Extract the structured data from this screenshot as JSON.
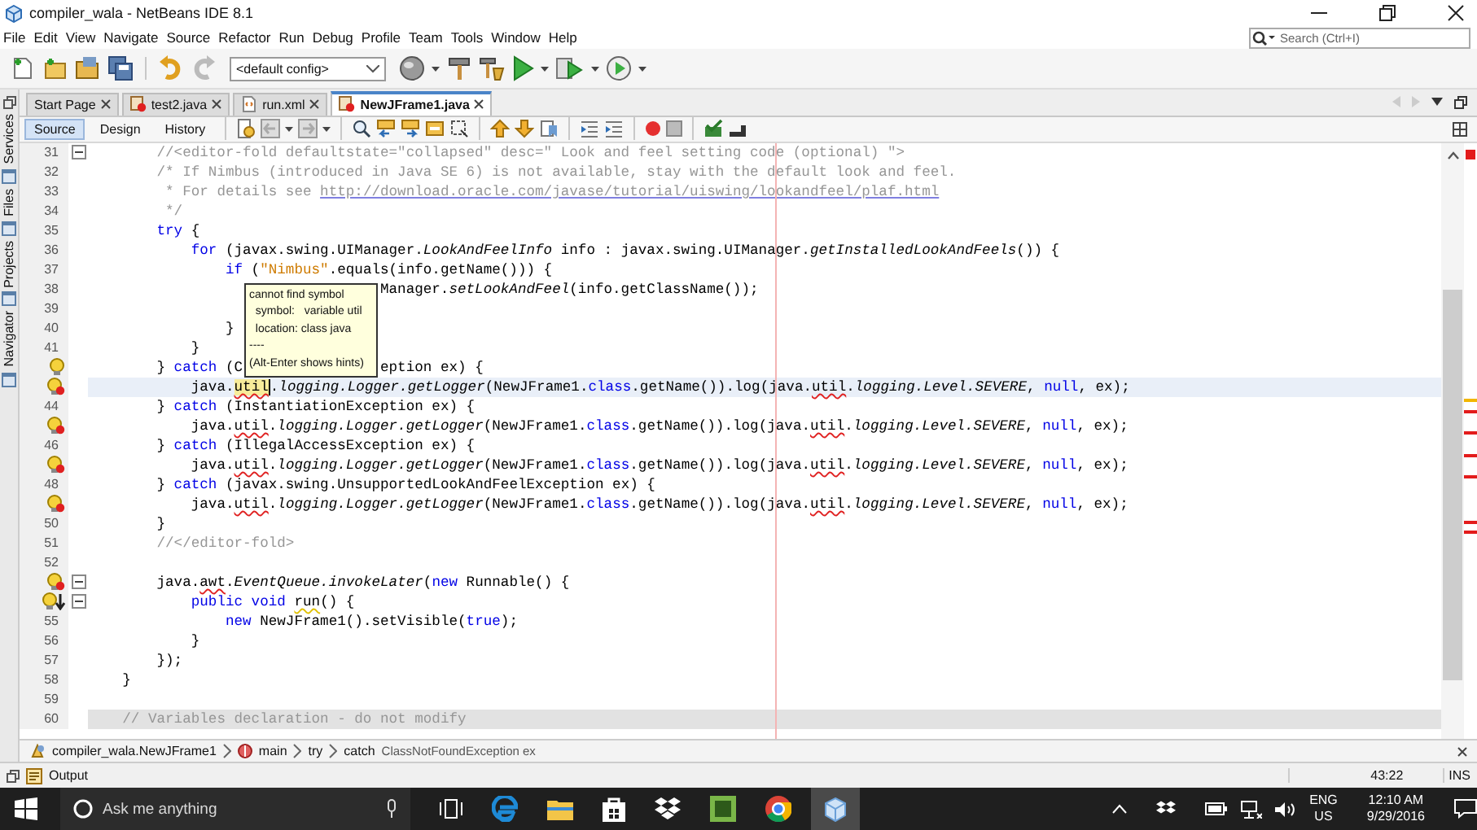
{
  "window": {
    "title": "compiler_wala - NetBeans IDE 8.1"
  },
  "menu": [
    "File",
    "Edit",
    "View",
    "Navigate",
    "Source",
    "Refactor",
    "Run",
    "Debug",
    "Profile",
    "Team",
    "Tools",
    "Window",
    "Help"
  ],
  "search": {
    "placeholder": "Search (Ctrl+I)"
  },
  "toolbar": {
    "config": "<default config>"
  },
  "side_tabs": [
    "Services",
    "Files",
    "Projects",
    "Navigator"
  ],
  "tabs": [
    {
      "label": "Start Page",
      "selected": false,
      "kind": "page"
    },
    {
      "label": "test2.java",
      "selected": false,
      "kind": "java-error"
    },
    {
      "label": "run.xml",
      "selected": false,
      "kind": "xml"
    },
    {
      "label": "NewJFrame1.java",
      "selected": true,
      "kind": "java-error"
    }
  ],
  "views": [
    {
      "label": "Source",
      "selected": true
    },
    {
      "label": "Design",
      "selected": false
    },
    {
      "label": "History",
      "selected": false
    }
  ],
  "editor": {
    "lines": [
      {
        "kind": "numbered",
        "number": "31",
        "fold": true,
        "current": false,
        "guarded": false,
        "segments": [
          {
            "kind": "comment",
            "text": "        //<editor-fold defaultstate=\"collapsed\" desc=\" Look and feel setting code (optional) \">"
          }
        ]
      },
      {
        "kind": "numbered",
        "number": "32",
        "fold": false,
        "current": false,
        "guarded": false,
        "segments": [
          {
            "kind": "comment",
            "text": "        /* If Nimbus (introduced in Java SE 6) is not available, stay with the default look and feel."
          }
        ]
      },
      {
        "kind": "numbered",
        "number": "33",
        "fold": false,
        "current": false,
        "guarded": false,
        "segments": [
          {
            "kind": "comment",
            "text": "         * For details see "
          },
          {
            "kind": "link",
            "text": "http://download.oracle.com/javase/tutorial/uiswing/lookandfeel/plaf.html"
          }
        ]
      },
      {
        "kind": "numbered",
        "number": "34",
        "fold": false,
        "current": false,
        "guarded": false,
        "segments": [
          {
            "kind": "comment",
            "text": "         */"
          }
        ]
      },
      {
        "kind": "numbered",
        "number": "35",
        "fold": false,
        "current": false,
        "guarded": false,
        "segments": [
          {
            "kind": "keyword",
            "text": "        try"
          },
          {
            "kind": "plain",
            "text": " {"
          }
        ]
      },
      {
        "kind": "numbered",
        "number": "36",
        "fold": false,
        "current": false,
        "guarded": false,
        "segments": [
          {
            "kind": "keyword",
            "text": "            for"
          },
          {
            "kind": "plain",
            "text": " (javax.swing.UIManager."
          },
          {
            "kind": "italic",
            "text": "LookAndFeelInfo"
          },
          {
            "kind": "plain",
            "text": " info : javax.swing.UIManager."
          },
          {
            "kind": "italic",
            "text": "getInstalledLookAndFeels"
          },
          {
            "kind": "plain",
            "text": "()) {"
          }
        ]
      },
      {
        "kind": "numbered",
        "number": "37",
        "fold": false,
        "current": false,
        "guarded": false,
        "segments": [
          {
            "kind": "keyword",
            "text": "                if"
          },
          {
            "kind": "plain",
            "text": " ("
          },
          {
            "kind": "string",
            "text": "\"Nimbus\""
          },
          {
            "kind": "plain",
            "text": ".equals(info.getName())) {"
          }
        ]
      },
      {
        "kind": "numbered",
        "number": "38",
        "fold": false,
        "current": false,
        "guarded": false,
        "segments": [
          {
            "kind": "covered"
          },
          {
            "kind": "plain",
            "text": "Manager."
          },
          {
            "kind": "italic",
            "text": "setLookAndFeel"
          },
          {
            "kind": "plain",
            "text": "(info.getClassName());"
          }
        ]
      },
      {
        "kind": "numbered",
        "number": "39",
        "fold": false,
        "current": false,
        "guarded": false
      },
      {
        "kind": "numbered",
        "number": "40",
        "fold": false,
        "current": false,
        "guarded": false,
        "segments": [
          {
            "kind": "plain",
            "text": "                }"
          }
        ]
      },
      {
        "kind": "numbered",
        "number": "41",
        "fold": false,
        "current": false,
        "guarded": false,
        "segments": [
          {
            "kind": "plain",
            "text": "            }"
          }
        ]
      },
      {
        "kind": "hint",
        "fold": false,
        "current": false,
        "guarded": false,
        "segments": [
          {
            "kind": "plain",
            "text": "        } "
          },
          {
            "kind": "keyword",
            "text": "catch"
          },
          {
            "kind": "plain",
            "text": " (C"
          },
          {
            "kind": "covered"
          },
          {
            "kind": "plain",
            "text": "eption ex) {"
          }
        ]
      },
      {
        "kind": "error",
        "fold": false,
        "current": true,
        "guarded": false,
        "segments": [
          {
            "kind": "plain",
            "text": "            java."
          },
          {
            "kind": "marked",
            "text": "util"
          },
          {
            "kind": "plain",
            "text": "."
          },
          {
            "kind": "italic",
            "text": "logging.Logger.getLogger"
          },
          {
            "kind": "plain",
            "text": "(NewJFrame1."
          },
          {
            "kind": "keyword",
            "text": "class"
          },
          {
            "kind": "plain",
            "text": ".getName()).log(java."
          },
          {
            "kind": "error",
            "text": "util"
          },
          {
            "kind": "plain",
            "text": "."
          },
          {
            "kind": "italic",
            "text": "logging.Level.SEVERE"
          },
          {
            "kind": "plain",
            "text": ", "
          },
          {
            "kind": "keyword",
            "text": "null"
          },
          {
            "kind": "plain",
            "text": ", ex);"
          }
        ]
      },
      {
        "kind": "numbered",
        "number": "44",
        "fold": false,
        "current": false,
        "guarded": false,
        "segments": [
          {
            "kind": "plain",
            "text": "        } "
          },
          {
            "kind": "keyword",
            "text": "catch"
          },
          {
            "kind": "plain",
            "text": " (InstantiationException ex) {"
          }
        ]
      },
      {
        "kind": "error",
        "fold": false,
        "current": false,
        "guarded": false,
        "segments": [
          {
            "kind": "plain",
            "text": "            java."
          },
          {
            "kind": "error",
            "text": "util"
          },
          {
            "kind": "plain",
            "text": "."
          },
          {
            "kind": "italic",
            "text": "logging.Logger.getLogger"
          },
          {
            "kind": "plain",
            "text": "(NewJFrame1."
          },
          {
            "kind": "keyword",
            "text": "class"
          },
          {
            "kind": "plain",
            "text": ".getName()).log(java."
          },
          {
            "kind": "error",
            "text": "util"
          },
          {
            "kind": "plain",
            "text": "."
          },
          {
            "kind": "italic",
            "text": "logging.Level.SEVERE"
          },
          {
            "kind": "plain",
            "text": ", "
          },
          {
            "kind": "keyword",
            "text": "null"
          },
          {
            "kind": "plain",
            "text": ", ex);"
          }
        ]
      },
      {
        "kind": "numbered",
        "number": "46",
        "fold": false,
        "current": false,
        "guarded": false,
        "segments": [
          {
            "kind": "plain",
            "text": "        } "
          },
          {
            "kind": "keyword",
            "text": "catch"
          },
          {
            "kind": "plain",
            "text": " (IllegalAccessException ex) {"
          }
        ]
      },
      {
        "kind": "error",
        "fold": false,
        "current": false,
        "guarded": false,
        "segments": [
          {
            "kind": "plain",
            "text": "            java."
          },
          {
            "kind": "error",
            "text": "util"
          },
          {
            "kind": "plain",
            "text": "."
          },
          {
            "kind": "italic",
            "text": "logging.Logger.getLogger"
          },
          {
            "kind": "plain",
            "text": "(NewJFrame1."
          },
          {
            "kind": "keyword",
            "text": "class"
          },
          {
            "kind": "plain",
            "text": ".getName()).log(java."
          },
          {
            "kind": "error",
            "text": "util"
          },
          {
            "kind": "plain",
            "text": "."
          },
          {
            "kind": "italic",
            "text": "logging.Level.SEVERE"
          },
          {
            "kind": "plain",
            "text": ", "
          },
          {
            "kind": "keyword",
            "text": "null"
          },
          {
            "kind": "plain",
            "text": ", ex);"
          }
        ]
      },
      {
        "kind": "numbered",
        "number": "48",
        "fold": false,
        "current": false,
        "guarded": false,
        "segments": [
          {
            "kind": "plain",
            "text": "        } "
          },
          {
            "kind": "keyword",
            "text": "catch"
          },
          {
            "kind": "plain",
            "text": " (javax.swing.UnsupportedLookAndFeelException ex) {"
          }
        ]
      },
      {
        "kind": "error",
        "fold": false,
        "current": false,
        "guarded": false,
        "segments": [
          {
            "kind": "plain",
            "text": "            java."
          },
          {
            "kind": "error",
            "text": "util"
          },
          {
            "kind": "plain",
            "text": "."
          },
          {
            "kind": "italic",
            "text": "logging.Logger.getLogger"
          },
          {
            "kind": "plain",
            "text": "(NewJFrame1."
          },
          {
            "kind": "keyword",
            "text": "class"
          },
          {
            "kind": "plain",
            "text": ".getName()).log(java."
          },
          {
            "kind": "error",
            "text": "util"
          },
          {
            "kind": "plain",
            "text": "."
          },
          {
            "kind": "italic",
            "text": "logging.Level.SEVERE"
          },
          {
            "kind": "plain",
            "text": ", "
          },
          {
            "kind": "keyword",
            "text": "null"
          },
          {
            "kind": "plain",
            "text": ", ex);"
          }
        ]
      },
      {
        "kind": "numbered",
        "number": "50",
        "fold": false,
        "current": false,
        "guarded": false,
        "segments": [
          {
            "kind": "plain",
            "text": "        }"
          }
        ]
      },
      {
        "kind": "numbered",
        "number": "51",
        "fold": false,
        "current": false,
        "guarded": false,
        "segments": [
          {
            "kind": "comment",
            "text": "        //</editor-fold>"
          }
        ]
      },
      {
        "kind": "numbered",
        "number": "52",
        "fold": false,
        "current": false,
        "guarded": false
      },
      {
        "kind": "error",
        "fold": true,
        "current": false,
        "guarded": false,
        "segments": [
          {
            "kind": "plain",
            "text": "        java."
          },
          {
            "kind": "error",
            "text": "awt"
          },
          {
            "kind": "plain",
            "text": "."
          },
          {
            "kind": "italic",
            "text": "EventQueue.invokeLater"
          },
          {
            "kind": "plain",
            "text": "("
          },
          {
            "kind": "keyword",
            "text": "new"
          },
          {
            "kind": "plain",
            "text": " Runnable() {"
          }
        ]
      },
      {
        "kind": "override",
        "fold": true,
        "current": false,
        "guarded": false,
        "segments": [
          {
            "kind": "keyword",
            "text": "            public void "
          },
          {
            "kind": "warning",
            "text": "run"
          },
          {
            "kind": "plain",
            "text": "() {"
          }
        ]
      },
      {
        "kind": "numbered",
        "number": "55",
        "fold": false,
        "current": false,
        "guarded": false,
        "segments": [
          {
            "kind": "keyword",
            "text": "                new"
          },
          {
            "kind": "plain",
            "text": " NewJFrame1().setVisible("
          },
          {
            "kind": "keyword",
            "text": "true"
          },
          {
            "kind": "plain",
            "text": ");"
          }
        ]
      },
      {
        "kind": "numbered",
        "number": "56",
        "fold": false,
        "current": false,
        "guarded": false,
        "segments": [
          {
            "kind": "plain",
            "text": "            }"
          }
        ]
      },
      {
        "kind": "numbered",
        "number": "57",
        "fold": false,
        "current": false,
        "guarded": false,
        "segments": [
          {
            "kind": "plain",
            "text": "        });"
          }
        ]
      },
      {
        "kind": "numbered",
        "number": "58",
        "fold": false,
        "current": false,
        "guarded": false,
        "segments": [
          {
            "kind": "plain",
            "text": "    }"
          }
        ]
      },
      {
        "kind": "numbered",
        "number": "59",
        "fold": false,
        "current": false,
        "guarded": false
      },
      {
        "kind": "numbered",
        "number": "60",
        "fold": false,
        "current": false,
        "guarded": true,
        "segments": [
          {
            "kind": "comment",
            "text": "    // Variables declaration - do not modify"
          }
        ]
      }
    ],
    "tooltip": [
      "cannot find symbol",
      "  symbol:   variable util",
      "  location: class java",
      "----",
      "(Alt-Enter shows hints)"
    ]
  },
  "breadcrumb": [
    {
      "label": "compiler_wala.NewJFrame1",
      "kind": "class"
    },
    {
      "label": "main",
      "kind": "method"
    },
    {
      "label": "try",
      "kind": "plain"
    },
    {
      "label": "catch",
      "detail": "ClassNotFoundException ex",
      "kind": "plain"
    }
  ],
  "status": {
    "output": "Output",
    "position": "43:22",
    "mode": "INS"
  },
  "taskbar": {
    "search_placeholder": "Ask me anything",
    "language": "ENG",
    "region": "US",
    "time": "12:10 AM",
    "date": "9/29/2016"
  }
}
